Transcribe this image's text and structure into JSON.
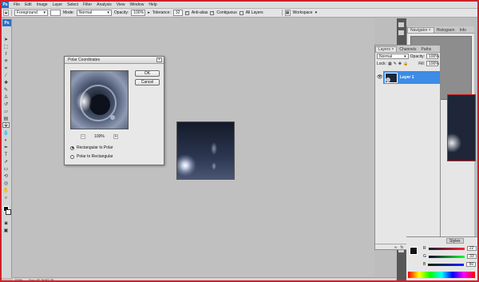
{
  "menubar": {
    "logo": "Ps",
    "items": [
      "File",
      "Edit",
      "Image",
      "Layer",
      "Select",
      "Filter",
      "Analysis",
      "View",
      "Window",
      "Help"
    ]
  },
  "options_bar": {
    "fill_source": "Foreground",
    "mode_label": "Mode:",
    "mode_value": "Normal",
    "opacity_label": "Opacity:",
    "opacity_value": "100%",
    "tolerance_label": "Tolerance:",
    "tolerance_value": "32",
    "anti_alias_label": "Anti-alias",
    "contiguous_label": "Contiguous",
    "all_layers_label": "All Layers",
    "workspace_label": "Workspace"
  },
  "dialog": {
    "title": "Polar Coordinates",
    "ok_label": "OK",
    "cancel_label": "Cancel",
    "zoom_value": "100%",
    "zoom_out": "−",
    "zoom_in": "+",
    "option_rect_to_polar": "Rectangular to Polar",
    "option_polar_to_rect": "Polar to Rectangular",
    "selected_option": "Rectangular to Polar"
  },
  "layers_panel": {
    "tabs": [
      "Layers ×",
      "Channels",
      "Paths"
    ],
    "blend_mode": "Normal",
    "opacity_label": "Opacity:",
    "opacity_value": "100%",
    "lock_label": "Lock:",
    "fill_label": "Fill:",
    "fill_value": "100%",
    "layer_name": "Layer 1"
  },
  "navigator_panel": {
    "tabs": [
      "Navigator ×",
      "Histogram",
      "Info"
    ]
  },
  "color_panel": {
    "tab": "Styles",
    "r_label": "R",
    "r_value": "22",
    "g_label": "G",
    "g_value": "33",
    "b_label": "B",
    "b_value": "50"
  },
  "status_bar": {
    "zoom": "100%",
    "doc": "Doc: 82.7K/82.7K"
  },
  "colors": {
    "accent": "#3d8ce6",
    "frame": "#d0202a",
    "workspace": "#c0c0c0"
  }
}
